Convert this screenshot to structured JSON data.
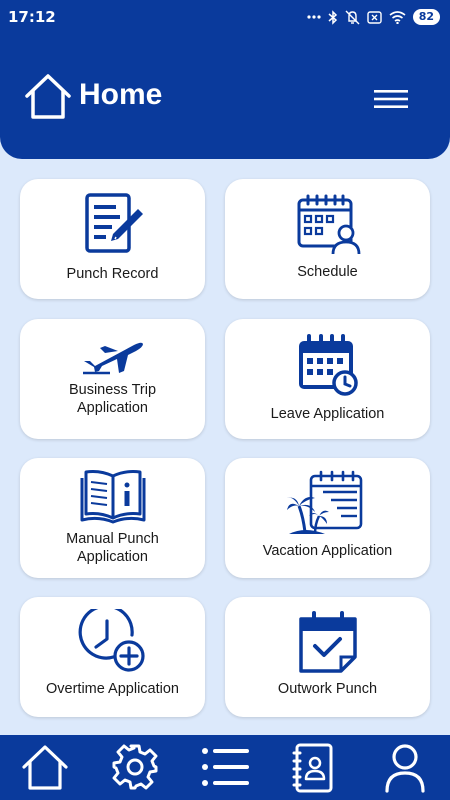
{
  "status_bar": {
    "time": "17:12",
    "battery": "82",
    "icons": [
      "dots-icon",
      "bluetooth-icon",
      "mute-icon",
      "sim-icon",
      "wifi-icon",
      "battery-icon"
    ]
  },
  "header": {
    "title": "Home",
    "icon": "home-icon",
    "menu_icon": "hamburger-menu-icon"
  },
  "cards": [
    {
      "label_lines": [
        "Punch Record"
      ],
      "icon": "document-edit-icon"
    },
    {
      "label_lines": [
        "Schedule"
      ],
      "icon": "calendar-person-icon"
    },
    {
      "label_lines": [
        "Business Trip",
        "Application"
      ],
      "icon": "airplane-icon"
    },
    {
      "label_lines": [
        "Leave Application"
      ],
      "icon": "calendar-clock-icon"
    },
    {
      "label_lines": [
        "Manual Punch",
        "Application"
      ],
      "icon": "open-book-info-icon"
    },
    {
      "label_lines": [
        "Vacation Application"
      ],
      "icon": "calendar-palm-tree-icon"
    },
    {
      "label_lines": [
        "Overtime Application"
      ],
      "icon": "clock-plus-icon"
    },
    {
      "label_lines": [
        "Outwork Punch"
      ],
      "icon": "calendar-check-icon"
    }
  ],
  "bottom_nav": [
    {
      "icon": "home-icon"
    },
    {
      "icon": "gear-icon"
    },
    {
      "icon": "list-icon"
    },
    {
      "icon": "contacts-book-icon"
    },
    {
      "icon": "user-icon"
    }
  ],
  "colors": {
    "primary": "#0a3a9c",
    "background": "#dce9fb",
    "card": "#ffffff",
    "icon": "#0a3a9c"
  }
}
